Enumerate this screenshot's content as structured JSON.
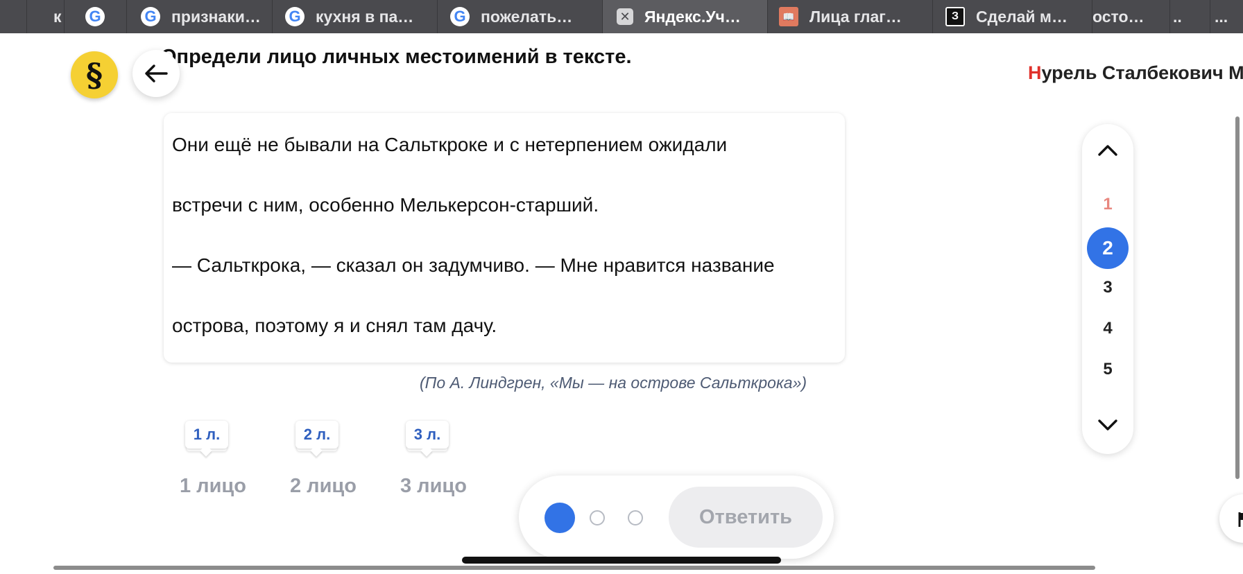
{
  "tabs": [
    {
      "label": "к",
      "icon": "google-icon"
    },
    {
      "label": "признаки…",
      "icon": "google-icon"
    },
    {
      "label": "кухня в па…",
      "icon": "google-icon"
    },
    {
      "label": "пожелать…",
      "icon": "google-icon"
    },
    {
      "label": "Яндекс.Уч…",
      "icon": "close-icon",
      "active": true
    },
    {
      "label": "Лица глаг…",
      "icon": "book-icon"
    },
    {
      "label": "Сделай м…",
      "icon": "z-icon"
    },
    {
      "label": "осто…"
    },
    {
      "label": ".."
    },
    {
      "label": "..."
    }
  ],
  "header": {
    "logo_glyph": "§",
    "task_title": "Определи лицо личных местоимений в тексте.",
    "user_initial": "Н",
    "user_rest": "урель Сталбекович М"
  },
  "text": {
    "lines": [
      "Они ещё не бывали на Сальткроке и с нетерпением ожидали",
      "встречи с ним, особенно Мелькерсон-старший.",
      "— Сальткрока, — сказал он задумчиво. — Мне нравится название",
      "острова, поэтому я и снял там дачу."
    ],
    "source": "(По А. Линдгрен,  «Мы —  на острове Сальткрока»)"
  },
  "persons": [
    {
      "tag": "1 л.",
      "label": "1 лицо"
    },
    {
      "tag": "2 л.",
      "label": "2 лицо"
    },
    {
      "tag": "3 л.",
      "label": "3 лицо"
    }
  ],
  "pager": {
    "pages": [
      "1",
      "2",
      "3",
      "4",
      "5"
    ],
    "current": "2",
    "colors": {
      "done": "#e8877f",
      "current": "#3273e6"
    }
  },
  "answer": {
    "button_label": "Ответить",
    "steps_total": 3,
    "step_current": 1
  },
  "colors": {
    "accent": "#3273e6",
    "logo": "#f5d033",
    "brand_red": "#e0312b"
  }
}
